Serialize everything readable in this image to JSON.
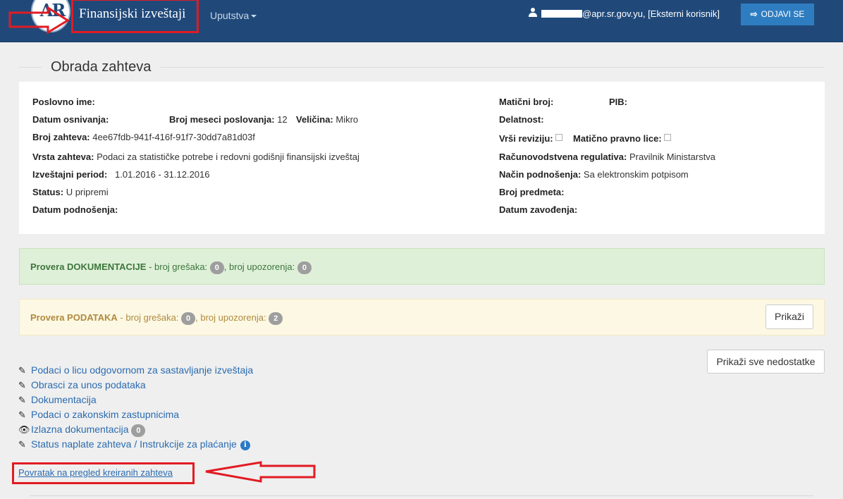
{
  "navbar": {
    "logo_text": "AR",
    "brand": "Finansijski izveštaji",
    "menu_label": "Uputstva",
    "user_email_suffix": "@apr.sr.gov.yu",
    "user_role": ", [Eksterni korisnik]",
    "logout_label": "ODJAVI SE",
    "logout_icon": "⇨"
  },
  "page": {
    "heading": "Obrada zahteva"
  },
  "info": {
    "poslovno_ime_label": "Poslovno ime:",
    "datum_osnivanja_label": "Datum osnivanja:",
    "broj_meseci_label": "Broj meseci poslovanja:",
    "broj_meseci_value": "12",
    "velicina_label": "Veličina:",
    "velicina_value": "Mikro",
    "broj_zahteva_label": "Broj zahteva:",
    "broj_zahteva_value": "4ee67fdb-941f-416f-91f7-30dd7a81d03f",
    "vrsta_zahteva_label": "Vrsta zahteva:",
    "vrsta_zahteva_value": "Podaci za statističke potrebe i redovni godišnji finansijski izveštaj",
    "period_label": "Izveštajni period:",
    "period_value": "1.01.2016 - 31.12.2016",
    "status_label": "Status:",
    "status_value": "U pripremi",
    "datum_podnosenja_label": "Datum podnošenja:",
    "maticni_broj_label": "Matični broj:",
    "pib_label": "PIB:",
    "delatnost_label": "Delatnost:",
    "vrsi_reviziju_label": "Vrši reviziju:",
    "maticno_pravno_lice_label": "Matično pravno lice:",
    "racunovodstvena_label": "Računovodstvena regulativa:",
    "racunovodstvena_value": "Pravilnik Ministarstva",
    "nacin_label": "Način podnošenja:",
    "nacin_value": "Sa elektronskim potpisom",
    "broj_predmeta_label": "Broj predmeta:",
    "datum_zavodjenja_label": "Datum zavođenja:"
  },
  "checks": {
    "documentation": {
      "title": "Provera DOKUMENTACIJE",
      "errors_label": " - broj grešaka:",
      "errors": "0",
      "warnings_label": ", broj upozorenja:",
      "warnings": "0"
    },
    "data": {
      "title": "Provera PODATAKA",
      "errors_label": " - broj grešaka:",
      "errors": "0",
      "warnings_label": ", broj upozorenja:",
      "warnings": "2",
      "show_button": "Prikaži"
    }
  },
  "show_all_button": "Prikaži sve nedostatke",
  "links": [
    {
      "label": "Podaci o licu odgovornom za sastavljanje izveštaja",
      "icon": "pencil-icon"
    },
    {
      "label": "Obrasci za unos podataka",
      "icon": "pencil-icon"
    },
    {
      "label": "Dokumentacija",
      "icon": "pencil-icon"
    },
    {
      "label": "Podaci o zakonskim zastupnicima",
      "icon": "pencil-icon"
    },
    {
      "label": "Izlazna dokumentacija",
      "icon": "eye-icon",
      "badge": "0"
    },
    {
      "label": "Status naplate zahteva / Instrukcije za plaćanje",
      "icon": "pencil-icon",
      "info": "i"
    }
  ],
  "back_link": "Povratak na pregled kreiranih zahteva",
  "colors": {
    "navbar": "#20497a",
    "accent": "#2f7dc1",
    "annotation": "#e21b23",
    "success_bg": "#dff0d8",
    "warning_bg": "#fcf8e3"
  }
}
